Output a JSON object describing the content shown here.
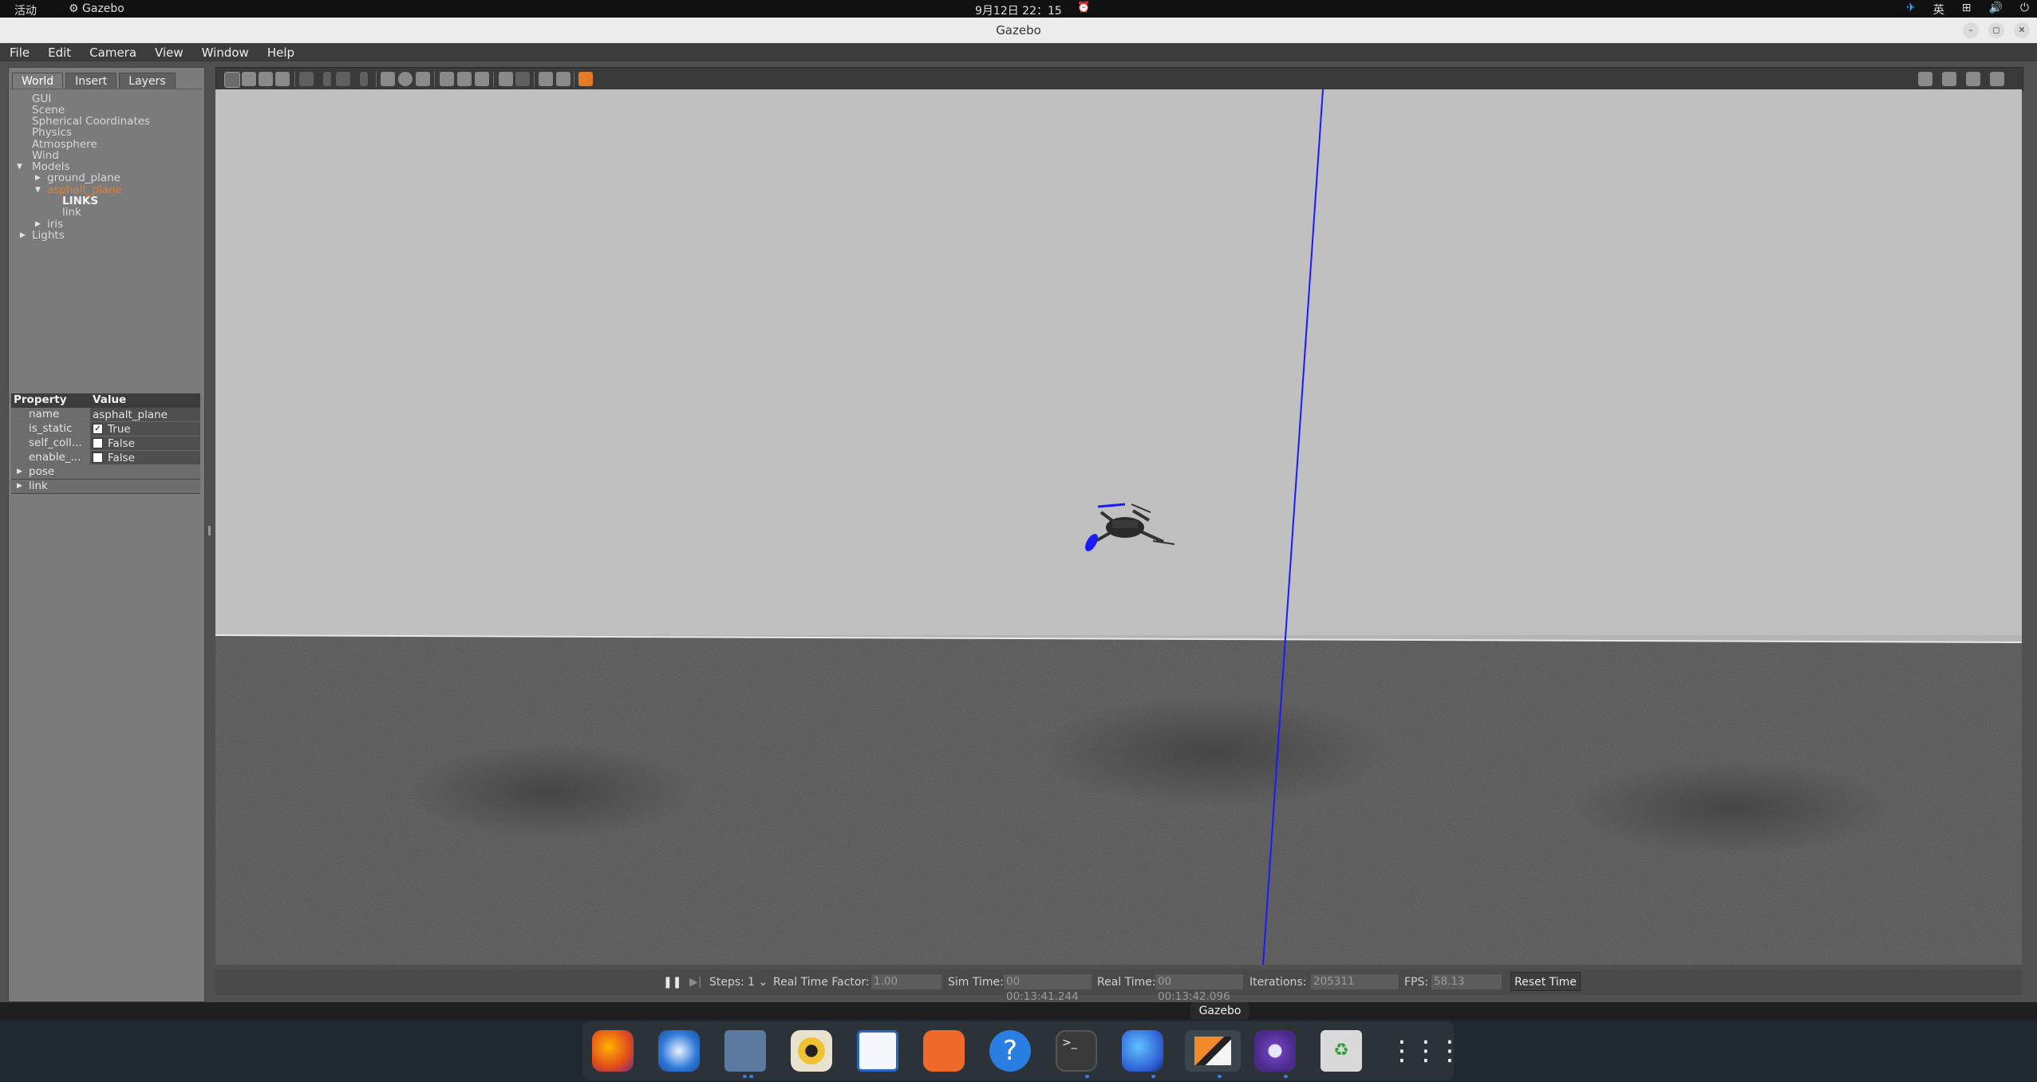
{
  "topbar": {
    "activities": "活动",
    "app_name": "Gazebo",
    "clock": "9月12日  22：15",
    "input_method": "英"
  },
  "window": {
    "title": "Gazebo"
  },
  "menu": [
    "File",
    "Edit",
    "Camera",
    "View",
    "Window",
    "Help"
  ],
  "left_panel": {
    "tabs": [
      "World",
      "Insert",
      "Layers"
    ],
    "active_tab": "World",
    "tree": {
      "gui": "GUI",
      "scene": "Scene",
      "spherical": "Spherical Coordinates",
      "physics": "Physics",
      "atmosphere": "Atmosphere",
      "wind": "Wind",
      "models": "Models",
      "ground_plane": "ground_plane",
      "asphalt_plane": "asphalt_plane",
      "links_header": "LINKS",
      "link": "link",
      "iris": "iris",
      "lights": "Lights"
    },
    "properties": {
      "header_property": "Property",
      "header_value": "Value",
      "rows": [
        {
          "key": "name",
          "value": "asphalt_plane"
        },
        {
          "key": "is_static",
          "value": "True",
          "checked": true
        },
        {
          "key": "self_coll...",
          "value": "False",
          "checked": false
        },
        {
          "key": "enable_...",
          "value": "False",
          "checked": false
        }
      ],
      "groups": [
        "pose",
        "link"
      ]
    }
  },
  "toolbar_icons": [
    "select-mode",
    "translate-mode",
    "rotate-mode",
    "scale-mode",
    "undo",
    "redo",
    "box",
    "sphere",
    "cylinder",
    "point-light",
    "spot-light",
    "directional-light",
    "copy",
    "paste",
    "align",
    "snap",
    "change-view",
    "screenshot",
    "log-data",
    "plot",
    "video-record"
  ],
  "bottom_bar": {
    "steps_label": "Steps:",
    "steps_value": "1",
    "rtf_label": "Real Time Factor:",
    "rtf_value": "1.00",
    "sim_time_label": "Sim Time:",
    "sim_time_value": "00 00:13:41.244",
    "real_time_label": "Real Time:",
    "real_time_value": "00 00:13:42.096",
    "iterations_label": "Iterations:",
    "iterations_value": "205311",
    "fps_label": "FPS:",
    "fps_value": "58.13",
    "reset_label": "Reset Time"
  },
  "dock": {
    "tooltip": "Gazebo",
    "apps": [
      "firefox",
      "thunderbird",
      "files",
      "rhythmbox",
      "libreoffice-writer",
      "app-center",
      "help",
      "terminal",
      "kali-app",
      "gazebo",
      "qgroundcontrol",
      "trash",
      "show-apps"
    ]
  },
  "colors": {
    "accent_selected": "#e87c29",
    "sky": "#c0c0c0",
    "ground": "#4d4d4d",
    "z_axis": "#1a1aff"
  }
}
